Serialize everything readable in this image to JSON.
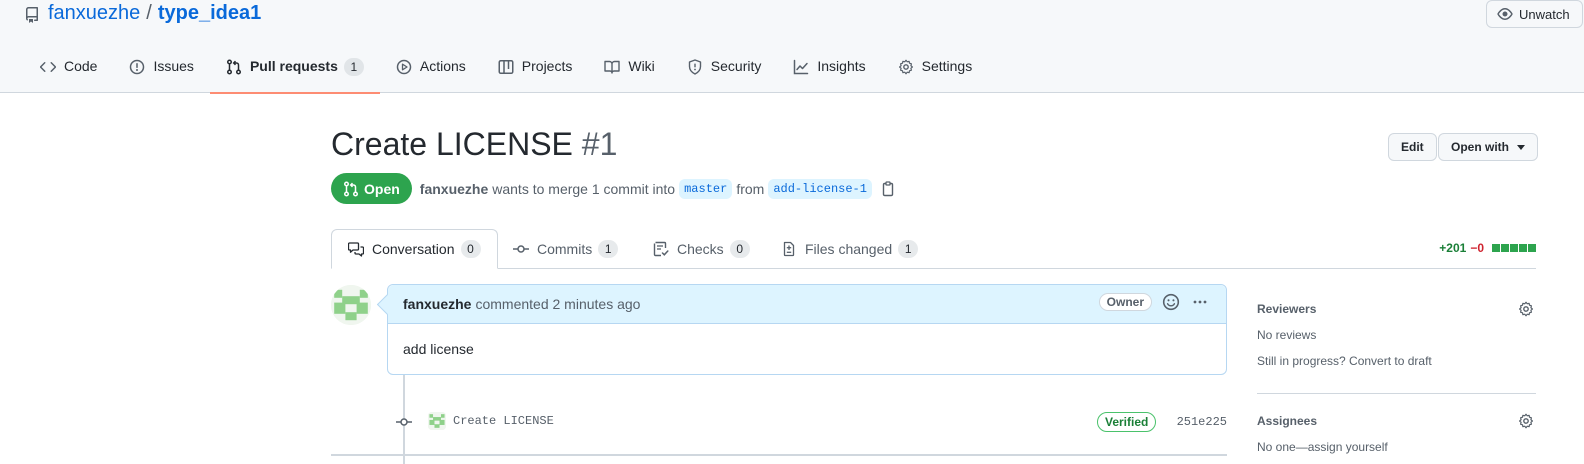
{
  "repo": {
    "owner": "fanxuezhe",
    "separator": "/",
    "name": "type_idea1",
    "watch_label": "Unwatch"
  },
  "nav": {
    "code": "Code",
    "issues": "Issues",
    "pull_requests": "Pull requests",
    "pull_requests_count": "1",
    "actions": "Actions",
    "projects": "Projects",
    "wiki": "Wiki",
    "security": "Security",
    "insights": "Insights",
    "settings": "Settings"
  },
  "pr": {
    "title": "Create LICENSE",
    "number": "#1",
    "edit_label": "Edit",
    "open_with_label": "Open with",
    "state": "Open",
    "author": "fanxuezhe",
    "merge_text": "wants to merge 1 commit into",
    "base_branch": "master",
    "from_text": "from",
    "head_branch": "add-license-1"
  },
  "tabs": {
    "conversation": "Conversation",
    "conversation_count": "0",
    "commits": "Commits",
    "commits_count": "1",
    "checks": "Checks",
    "checks_count": "0",
    "files_changed": "Files changed",
    "files_changed_count": "1",
    "additions": "+201",
    "deletions": "−0",
    "diff_blocks": 5
  },
  "comment": {
    "author": "fanxuezhe",
    "meta": "commented 2 minutes ago",
    "role_badge": "Owner",
    "body": "add license"
  },
  "commit": {
    "message": "Create LICENSE",
    "verified_label": "Verified",
    "sha": "251e225"
  },
  "sidebar": {
    "reviewers_heading": "Reviewers",
    "reviewers_value": "No reviews",
    "draft_hint": "Still in progress? Convert to draft",
    "assignees_heading": "Assignees",
    "assignees_value": "No one—assign yourself"
  },
  "colors": {
    "open_state": "#2da44e",
    "link": "#0969da",
    "active_tab_underline": "#fd8c73",
    "verified": "#1a7f37"
  }
}
